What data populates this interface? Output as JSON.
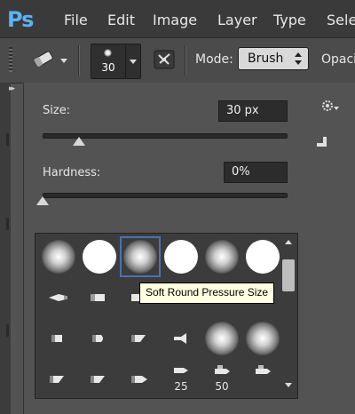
{
  "app": {
    "logo": "Ps"
  },
  "menu": [
    "File",
    "Edit",
    "Image",
    "Layer",
    "Type",
    "Selec"
  ],
  "options_bar": {
    "brush_size": "30",
    "mode_label": "Mode:",
    "mode_value": "Brush",
    "opacity_label": "Opaci"
  },
  "panel": {
    "size_label": "Size:",
    "size_value": "30 px",
    "size_slider": 0.15,
    "hardness_label": "Hardness:",
    "hardness_value": "0%",
    "hardness_slider": 0.0
  },
  "brushes": {
    "row1": [
      "soft",
      "hard",
      "soft-selected",
      "hard",
      "soft",
      "hard"
    ],
    "row4_labels": [
      "",
      "",
      "",
      "25",
      "50",
      ""
    ],
    "tooltip": "Soft Round Pressure Size"
  },
  "colors": {
    "accent": "#4a72b5",
    "logo": "#5bb3f2",
    "tooltip_bg": "#ffffe1"
  }
}
